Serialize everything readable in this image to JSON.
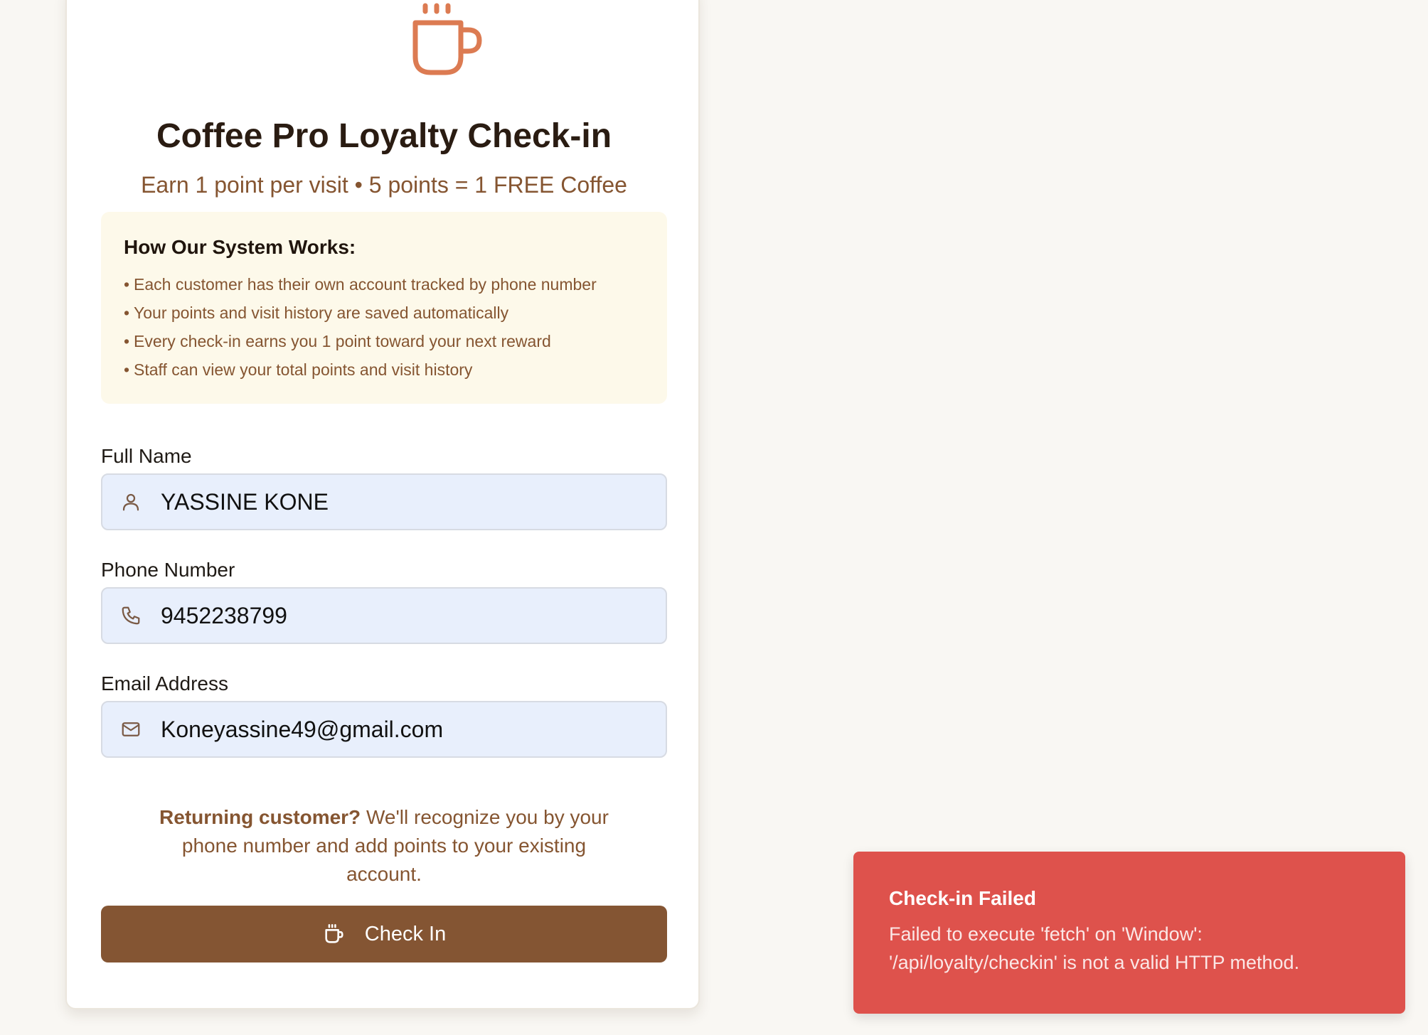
{
  "brand": {
    "accent": "#845533",
    "logo_color": "#dc7b52",
    "error_color": "#de524c"
  },
  "header": {
    "logo_icon": "coffee-cup-icon",
    "title": "Coffee Pro Loyalty Check-in",
    "subtitle": "Earn 1 point per visit • 5 points = 1 FREE Coffee"
  },
  "info": {
    "title": "How Our System Works:",
    "items": [
      "Each customer has their own account tracked by phone number",
      "Your points and visit history are saved automatically",
      "Every check-in earns you 1 point toward your next reward",
      "Staff can view your total points and visit history"
    ]
  },
  "form": {
    "name": {
      "label": "Full Name",
      "value": "YASSINE KONE",
      "icon": "user-icon"
    },
    "phone": {
      "label": "Phone Number",
      "value": "9452238799",
      "icon": "phone-icon"
    },
    "email": {
      "label": "Email Address",
      "value": "Koneyassine49@gmail.com",
      "icon": "mail-icon"
    }
  },
  "note": {
    "bold": "Returning customer?",
    "text": " We'll recognize you by your phone number and add points to your existing account."
  },
  "button": {
    "label": "Check In",
    "icon": "coffee-cup-icon"
  },
  "toast": {
    "title": "Check-in Failed",
    "message": "Failed to execute 'fetch' on 'Window': '/api/loyalty/checkin' is not a valid HTTP method."
  }
}
